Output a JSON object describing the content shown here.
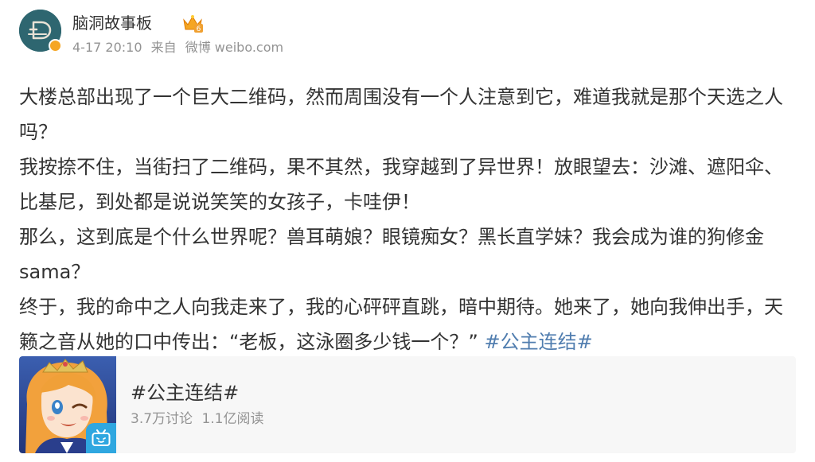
{
  "author": {
    "name": "脑洞故事板",
    "avatar_icon": "d-logo-avatar-icon",
    "verified_icon": "verified-badge-icon",
    "vip_icon": "crown-vip-icon",
    "vip_level": "6"
  },
  "meta": {
    "time": "4-17 20:10",
    "source_prefix": "来自",
    "source": "微博 weibo.com"
  },
  "post": {
    "paragraphs": [
      "大楼总部出现了一个巨大二维码，然而周围没有一个人注意到它，难道我就是那个天选之人吗？",
      "我按捺不住，当街扫了二维码，果不其然，我穿越到了异世界！放眼望去：沙滩、遮阳伞、比基尼，到处都是说说笑笑的女孩子，卡哇伊！",
      "那么，这到底是个什么世界呢？兽耳萌娘？眼镜痴女？黑长直学妹？我会成为谁的狗修金sama？",
      "终于，我的命中之人向我走来了，我的心砰砰直跳，暗中期待。她来了，她向我伸出手，天籁之音从她的口中传出：“老板，这泳圈多少钱一个？”"
    ],
    "topic_link": "#公主连结#"
  },
  "topic_card": {
    "title": "#公主连结#",
    "discussions": "3.7万讨论",
    "reads": "1.1亿阅读",
    "cover_icon": "anime-girl-cover-image",
    "badge_icon": "bilibili-tv-icon"
  },
  "colors": {
    "link": "#507daf",
    "text": "#333333",
    "meta": "#939393",
    "card_bg": "#f7f7f7",
    "avatar_bg": "#2e6670",
    "vip_gold": "#f5a623",
    "bili_blue": "#2fa7e0"
  }
}
